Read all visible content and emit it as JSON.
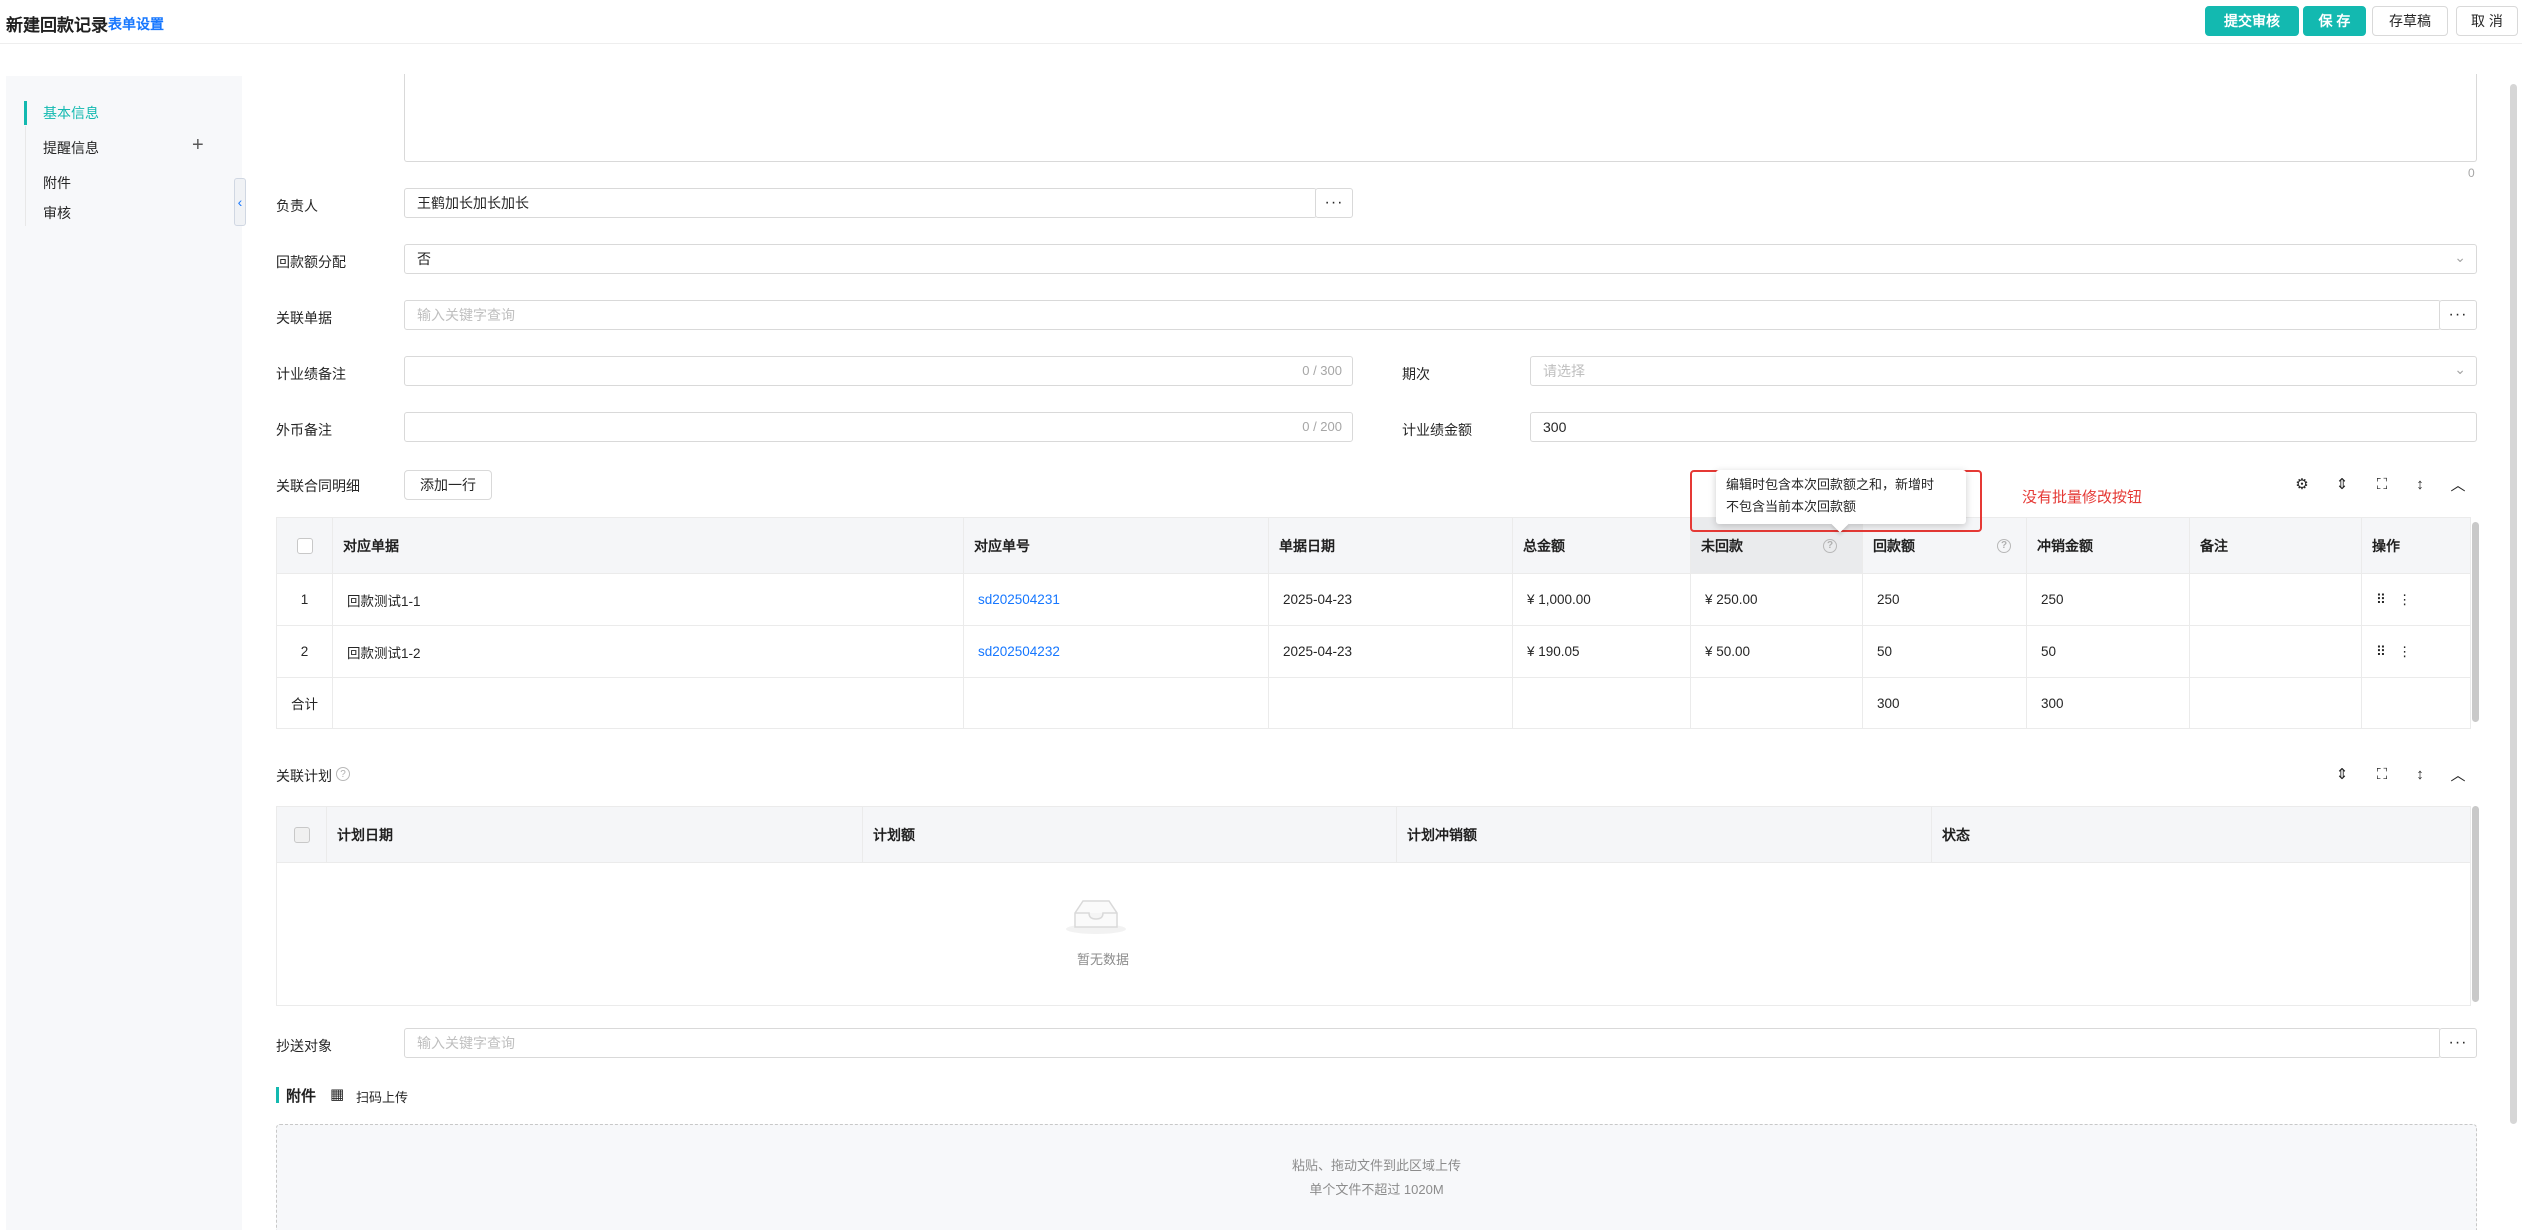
{
  "header": {
    "title": "新建回款记录",
    "settings_link": "表单设置",
    "buttons": {
      "submit_review": "提交审核",
      "save": "保 存",
      "save_draft": "存草稿",
      "cancel": "取 消"
    }
  },
  "sidebar": {
    "items": [
      {
        "label": "基本信息",
        "active": true
      },
      {
        "label": "提醒信息"
      },
      {
        "label": "附件"
      },
      {
        "label": "审核"
      }
    ],
    "add_icon": "plus-icon",
    "collapse_icon": "chevron-left-icon"
  },
  "form": {
    "textarea_counter": "0",
    "owner": {
      "label": "负责人",
      "value": "王鹤加长加长加长"
    },
    "allocation": {
      "label": "回款额分配",
      "value": "否"
    },
    "related_doc": {
      "label": "关联单据",
      "placeholder": "输入关键字查询"
    },
    "perf_note": {
      "label": "计业绩备注",
      "counter": "0 / 300"
    },
    "period": {
      "label": "期次",
      "placeholder": "请选择"
    },
    "fx_note": {
      "label": "外币备注",
      "counter": "0 / 200"
    },
    "perf_amount": {
      "label": "计业绩金额",
      "value": "300"
    },
    "cc": {
      "label": "抄送对象",
      "placeholder": "输入关键字查询"
    }
  },
  "contract_detail": {
    "title": "关联合同明细",
    "add_row": "添加一行",
    "columns": [
      "对应单据",
      "对应单号",
      "单据日期",
      "总金额",
      "未回款",
      "回款额",
      "冲销金额",
      "备注",
      "操作"
    ],
    "rows": [
      {
        "index": "1",
        "doc": "回款测试1-1",
        "doc_no": "sd202504231",
        "date": "2025-04-23",
        "total": "¥ 1,000.00",
        "unpaid": "¥ 250.00",
        "payment": "250",
        "writeoff": "250",
        "note": ""
      },
      {
        "index": "2",
        "doc": "回款测试1-2",
        "doc_no": "sd202504232",
        "date": "2025-04-23",
        "total": "¥ 190.05",
        "unpaid": "¥ 50.00",
        "payment": "50",
        "writeoff": "50",
        "note": ""
      }
    ],
    "total_row": {
      "label": "合计",
      "payment": "300",
      "writeoff": "300"
    },
    "tooltip": "编辑时包含本次回款额之和，新增时不包含当前本次回款额",
    "tooltip_line1": "编辑时包含本次回款额之和，新增时",
    "tooltip_line2": "不包含当前本次回款额",
    "annotation": "没有批量修改按钮"
  },
  "plan": {
    "title": "关联计划",
    "columns": [
      "计划日期",
      "计划额",
      "计划冲销额",
      "状态"
    ],
    "empty_text": "暂无数据"
  },
  "attachment": {
    "title": "附件",
    "scan_upload": "扫码上传",
    "drop_hint": "粘贴、拖动文件到此区域上传",
    "size_hint": "单个文件不超过 1020M"
  },
  "colors": {
    "primary": "#13b9b0",
    "link": "#1677ff",
    "annotation_red": "#e53935"
  }
}
